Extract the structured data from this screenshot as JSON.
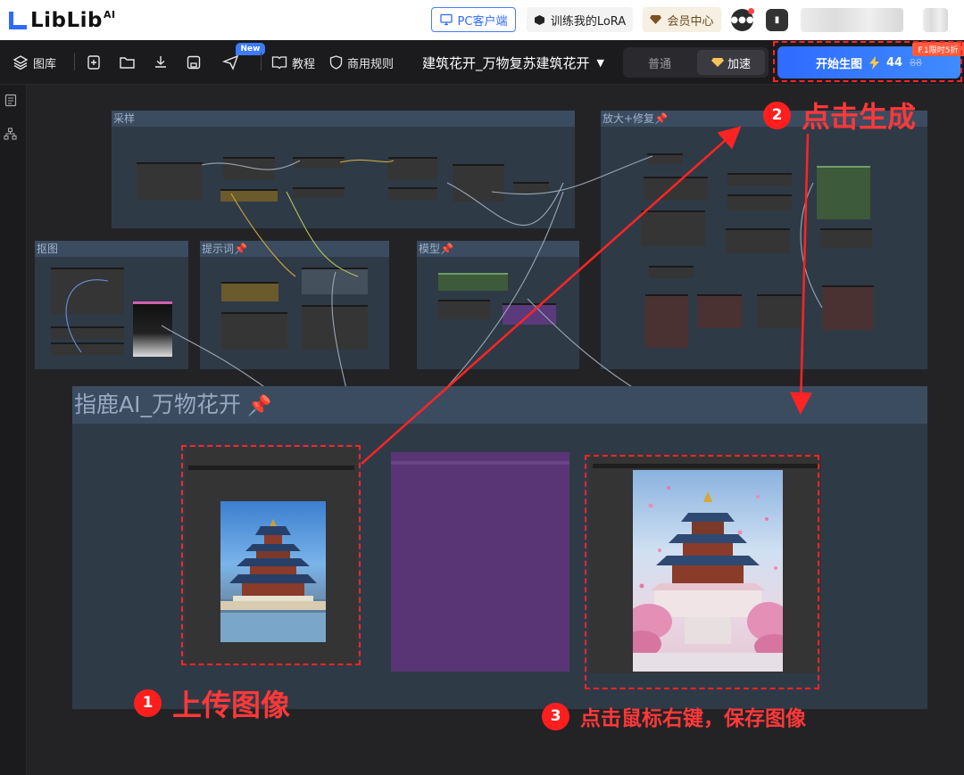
{
  "header": {
    "logo_text": "LibLib",
    "logo_sup": "AI",
    "pc_client": "PC客户端",
    "train_lora": "训练我的LoRA",
    "vip_center": "会员中心"
  },
  "toolbar": {
    "gallery": "图库",
    "new_badge": "New",
    "tutorial": "教程",
    "commercial_rules": "商用规则",
    "workflow_title": "建筑花开_万物复苏建筑花开",
    "mode_normal": "普通",
    "mode_fast": "加速",
    "generate_label": "开始生图",
    "generate_cost": "44",
    "generate_old_cost": "88",
    "promo_text": "F.1限时5折"
  },
  "canvas": {
    "groups": {
      "sampling": "采样",
      "upscale": "放大+修复",
      "matting": "抠图",
      "prompt": "提示词",
      "model": "模型"
    },
    "main_group_title": "指鹿AI_万物花开"
  },
  "annotations": {
    "step1_num": "1",
    "step1_text": "上传图像",
    "step2_num": "2",
    "step2_text": "点击生成",
    "step3_num": "3",
    "step3_text": "点击鼠标右键，保存图像"
  },
  "colors": {
    "accent": "#2f6bff",
    "annotation_red": "#ff2424",
    "group_bg": "#2f3a47",
    "group_title": "#3b4c60"
  }
}
